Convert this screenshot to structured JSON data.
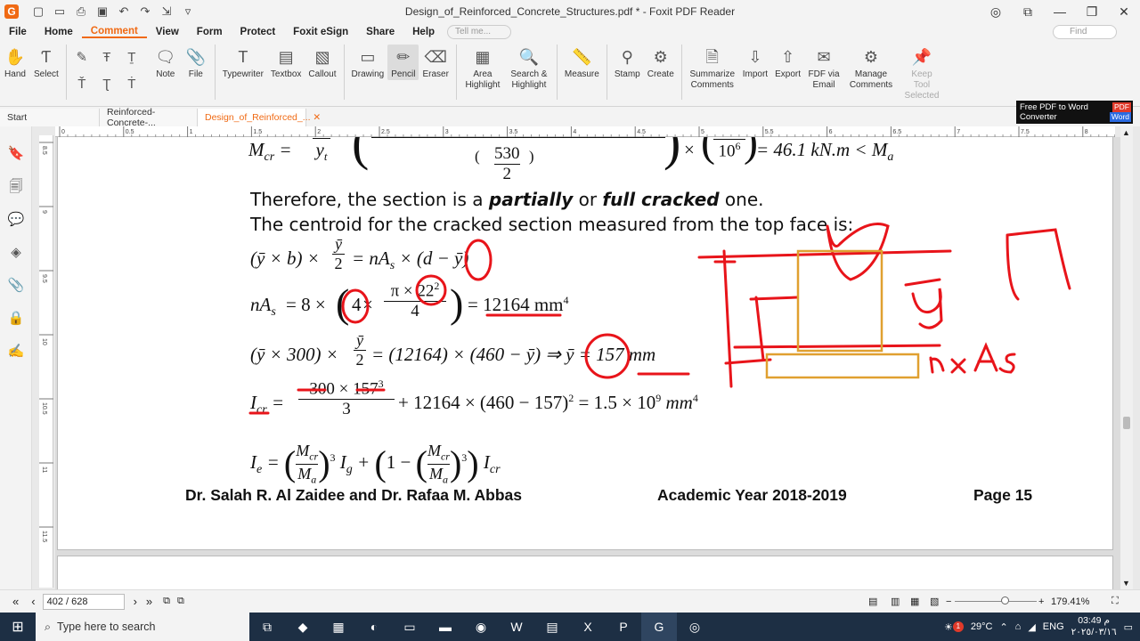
{
  "window": {
    "title": "Design_of_Reinforced_Concrete_Structures.pdf * - Foxit PDF Reader",
    "logo_letter": "G"
  },
  "menu": {
    "items": [
      "File",
      "Home",
      "Comment",
      "View",
      "Form",
      "Protect",
      "Foxit eSign",
      "Share",
      "Help"
    ],
    "active": "Comment",
    "tell_me_placeholder": "Tell me...",
    "find_placeholder": "Find"
  },
  "ribbon": {
    "hand": "Hand",
    "select": "Select",
    "note": "Note",
    "file": "File",
    "typewriter": "Typewriter",
    "textbox": "Textbox",
    "callout": "Callout",
    "drawing": "Drawing",
    "pencil": "Pencil",
    "eraser": "Eraser",
    "area_highlight": "Area Highlight",
    "search_highlight": "Search & Highlight",
    "measure": "Measure",
    "stamp": "Stamp",
    "create": "Create",
    "summarize": "Summarize Comments",
    "import": "Import",
    "export": "Export",
    "fdf_email": "FDF via Email",
    "manage": "Manage Comments",
    "keep_tool": "Keep Tool Selected"
  },
  "tabs": {
    "start": "Start",
    "doc1": "Reinforced-Concrete-...",
    "doc2": "Design_of_Reinforced_..."
  },
  "ad": {
    "line1": "Free PDF to Word",
    "line2": "Converter",
    "pdf": "PDF",
    "word": "Word"
  },
  "ruler": {
    "h_ticks": [
      "0",
      "0.5",
      "1",
      "1.5",
      "2",
      "2.5",
      "3",
      "3.5",
      "4",
      "4.5",
      "5",
      "5.5",
      "6",
      "6.5",
      "7",
      "7.5",
      "8"
    ],
    "v_ticks": [
      "8.5",
      "9",
      "9.5",
      "10",
      "10.5",
      "11",
      "11.5"
    ]
  },
  "doc": {
    "line_mcr_left": "M",
    "line_mcr_val": "= 46.1 kN.m < M",
    "frac_530": "530",
    "frac_2": "2",
    "frac_106": "10",
    "frac_yt": "y",
    "therefore": "Therefore, the section is a ",
    "partially": "partially",
    "or": " or ",
    "full_cracked": "full cracked",
    "one": " one.",
    "centroid": "The centroid for the cracked section measured from the top face is:",
    "eq1_left": "(ȳ × b) ×",
    "eq1_frac_num": "ȳ",
    "eq1_frac_den": "2",
    "eq1_right": "= nA",
    "eq1_tail": "× (d − ȳ)",
    "eq2_left": "nA",
    "eq2_mid": "= 8 × ",
    "eq2_4": "4",
    "eq2_times": " ×",
    "eq2_num": "π × 22",
    "eq2_den": "4",
    "eq2_right": "= 12164 mm",
    "eq3_left": "(ȳ × 300) ×",
    "eq3_num": "ȳ",
    "eq3_den": "2",
    "eq3_right": "= (12164) × (460 − ȳ) ⇒ ȳ = 157 mm",
    "eq4_left": "I",
    "eq4_sub": "cr",
    "eq4_num": "300 × 157",
    "eq4_den": "3",
    "eq4_right": "+ 12164 × (460 − 157)",
    "eq4_tail": "= 1.5 × 10",
    "eq4_unit": "mm",
    "eq5": "I",
    "footer_authors": "Dr. Salah R. Al Zaidee and Dr. Rafaa M. Abbas",
    "footer_year": "Academic Year 2018-2019",
    "footer_page": "Page 15"
  },
  "annotations": {
    "ink_color": "#e8141a",
    "box_color": "#e0a030",
    "handwritten": [
      "b",
      "ȳ",
      "n×As"
    ]
  },
  "status": {
    "page_value": "402 / 628",
    "zoom": "179.41%"
  },
  "taskbar": {
    "search_placeholder": "Type here to search",
    "temperature": "29°C",
    "lang": "ENG",
    "time": "03:49 م",
    "date": "٢٠٢٥/٠٣/١٦",
    "notif": "1"
  }
}
